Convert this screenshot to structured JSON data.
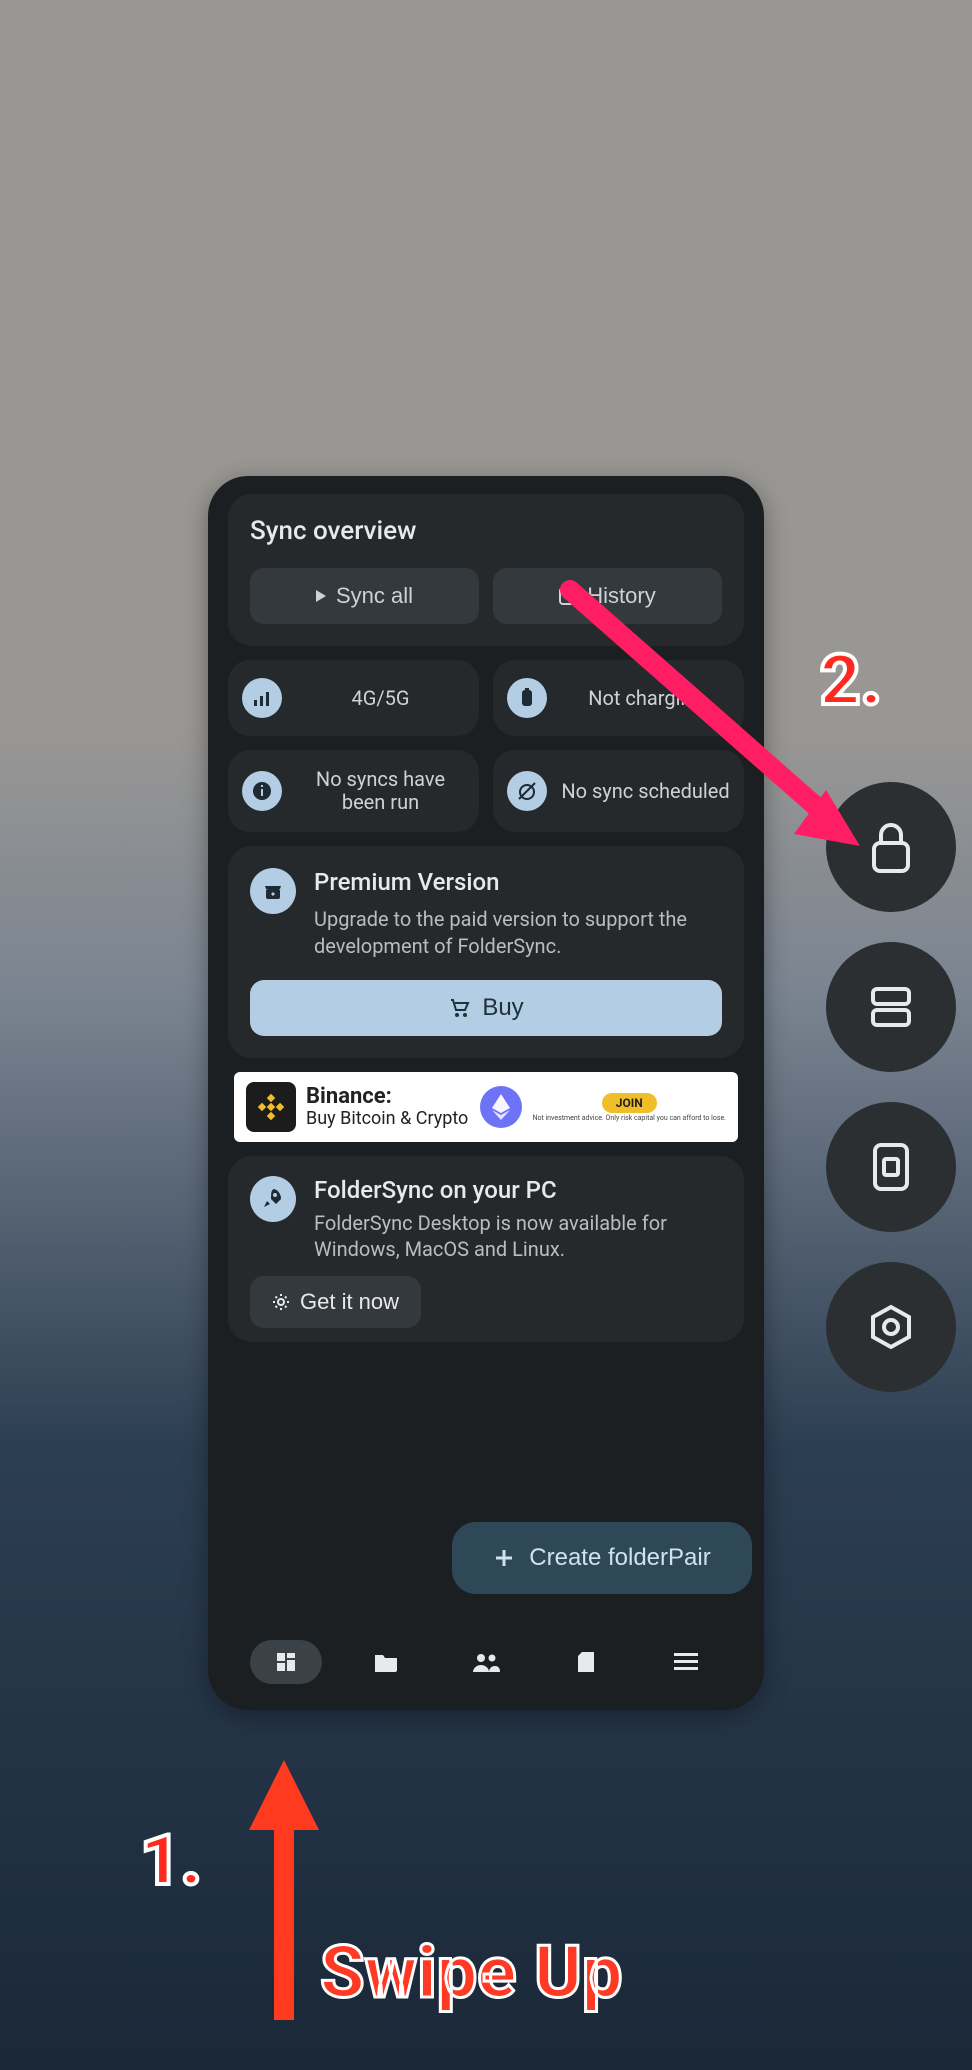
{
  "app": {
    "overview_title": "Sync overview",
    "sync_all": "Sync all",
    "history": "History",
    "status": {
      "network": "4G/5G",
      "charge": "Not charging",
      "syncs": "No syncs have been run",
      "schedule": "No sync scheduled"
    },
    "premium": {
      "title": "Premium Version",
      "body": "Upgrade to the paid version to support the development of FolderSync.",
      "buy_label": "Buy"
    },
    "ad": {
      "brand": "Binance:",
      "line": "Buy Bitcoin & Crypto",
      "cta": "JOIN",
      "fine": "Not investment advice. Only risk capital you can afford to lose."
    },
    "pc": {
      "title": "FolderSync on your PC",
      "body": "FolderSync Desktop is now available for Windows, MacOS and Linux.",
      "btn": "Get it now"
    },
    "fab": "Create folderPair"
  },
  "annotations": {
    "step1": "1.",
    "step2": "2.",
    "swipe": "Swipe Up"
  },
  "side_buttons": [
    "lock",
    "split",
    "screenshot",
    "settings"
  ]
}
